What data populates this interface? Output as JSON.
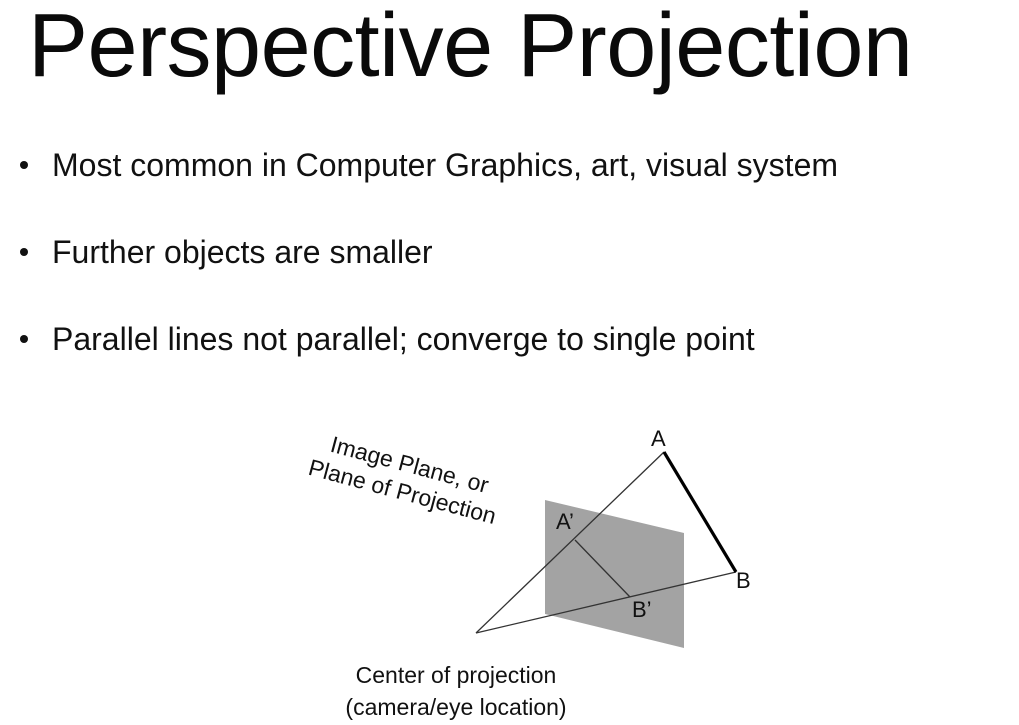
{
  "title": "Perspective Projection",
  "bullets": [
    "Most common in Computer Graphics, art, visual system",
    "Further objects are smaller",
    "Parallel lines not parallel; converge to single point"
  ],
  "diagram": {
    "plane_label_line1": "Image Plane, or",
    "plane_label_line2": "Plane of Projection",
    "point_a": "A",
    "point_b": "B",
    "point_a_prime": "A’",
    "point_b_prime": "B’",
    "center_label_line1": "Center of projection",
    "center_label_line2": "(camera/eye location)",
    "plane_color": "#a3a3a3"
  }
}
